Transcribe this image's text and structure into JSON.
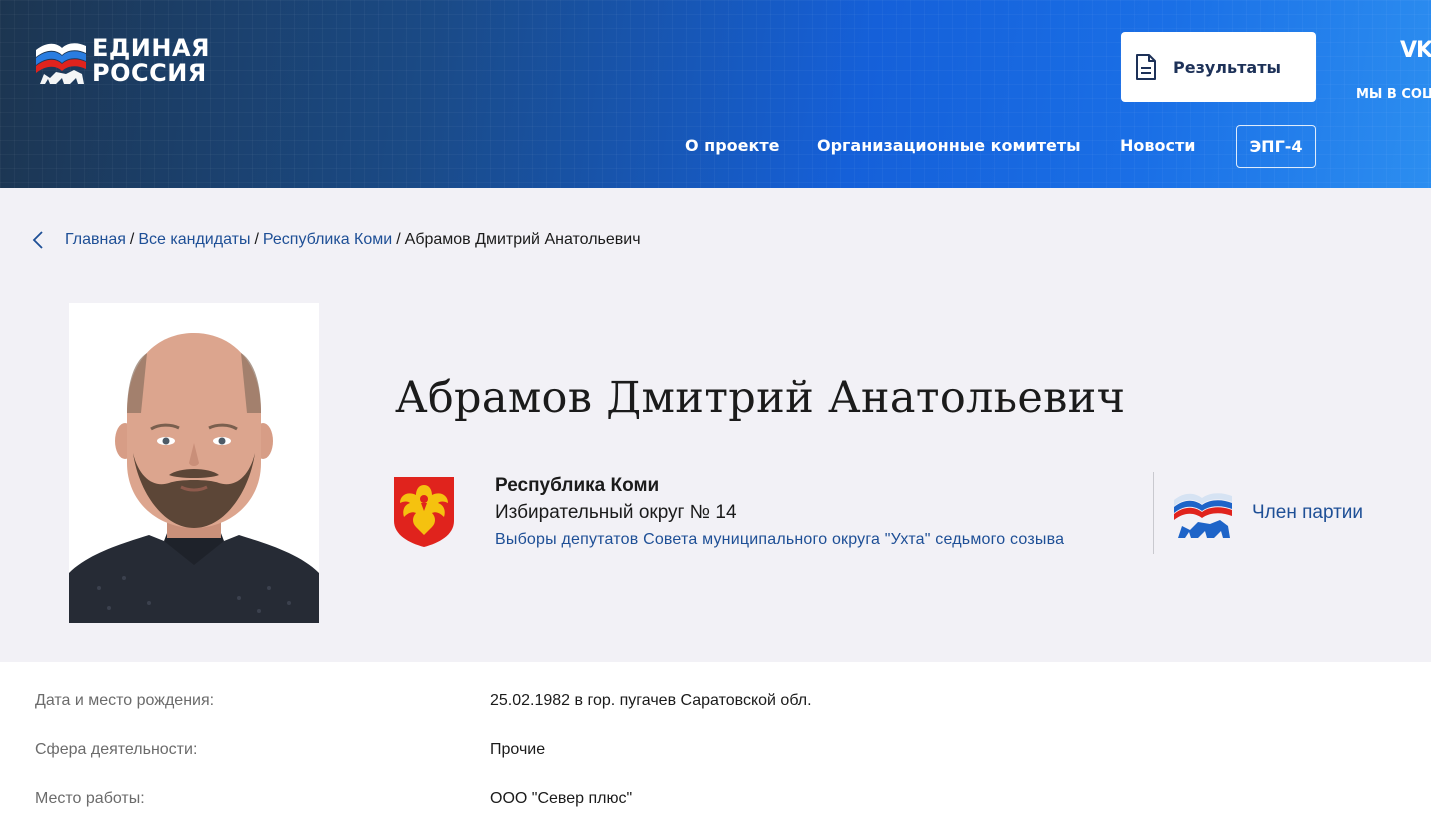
{
  "header": {
    "logo": {
      "line1": "ЕДИНАЯ",
      "line2": "РОССИЯ"
    },
    "results_button": {
      "label": "Результаты",
      "icon": "document-icon"
    },
    "social": {
      "icon": "vk-icon",
      "icon_text": "VK",
      "label": "МЫ В СОЦ"
    },
    "nav": {
      "about": "О проекте",
      "committees": "Организационные комитеты",
      "news": "Новости",
      "epg": "ЭПГ-4"
    }
  },
  "breadcrumb": {
    "items": [
      "Главная",
      "Все кандидаты",
      "Республика Коми"
    ],
    "separator": "/",
    "current": "Абрамов Дмитрий Анатольевич"
  },
  "candidate": {
    "name": "Абрамов Дмитрий Анатольевич",
    "region": "Республика Коми",
    "district": "Избирательный округ № 14",
    "election": "Выборы депутатов Совета муниципального округа \"Ухта\" седьмого созыва",
    "party_status": "Член партии"
  },
  "info": [
    {
      "label": "Дата и место рождения:",
      "value": "25.02.1982 в гор. пугачев Саратовской обл."
    },
    {
      "label": "Сфера деятельности:",
      "value": "Прочие"
    },
    {
      "label": "Место работы:",
      "value": "ООО \"Север плюс\""
    }
  ],
  "colors": {
    "brand_blue": "#1560d9",
    "link": "#1e4f96",
    "emblem_red": "#e0231d",
    "emblem_gold": "#f5c20f",
    "page_bg": "#f2f1f6"
  }
}
